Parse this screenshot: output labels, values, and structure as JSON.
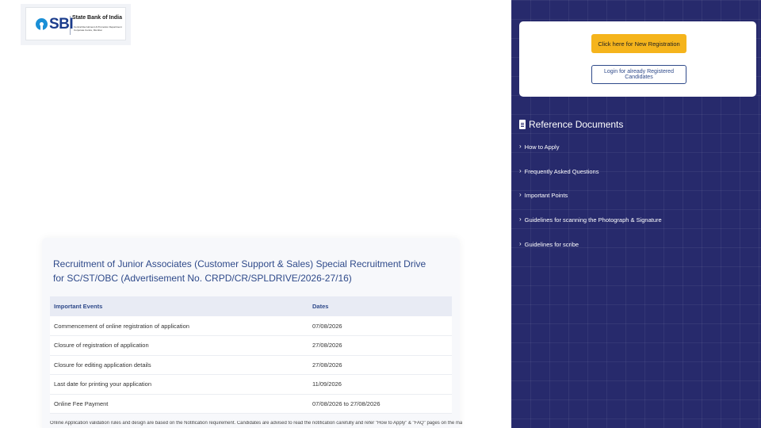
{
  "logo": {
    "brand_text": "SBI",
    "bank_name": "State Bank of India",
    "department_line1": "Central Recruitment & Promotion Department",
    "department_line2": "Corporate Centre, Mumbai"
  },
  "notice": {
    "title": "Recruitment of Junior Associates (Customer Support & Sales) Special Recruitment Drive for SC/ST/OBC (Advertisement No. CRPD/CR/SPLDRIVE/2026-27/16)",
    "table": {
      "headers": [
        "Important Events",
        "Dates"
      ],
      "rows": [
        [
          "Commencement of online registration of application",
          "07/08/2026"
        ],
        [
          "Closure of registration of application",
          "27/08/2026"
        ],
        [
          "Closure for editing application details",
          "27/08/2026"
        ],
        [
          "Last date for printing your application",
          "11/09/2026"
        ],
        [
          "Online Fee Payment",
          "07/08/2026 to 27/08/2026"
        ]
      ]
    },
    "footnote": "Online Application validation rules and design are based on the Notification requirement. Candidates are advised to read the notification carefully and refer \"How to Apply\" & \"FAQ\" pages on the main page. Application submitted through"
  },
  "sidebar": {
    "new_registration_label": "Click here for New Registration",
    "login_label": "Login for already Registered Candidates",
    "reference_heading": "Reference Documents",
    "reference_icon": "document-icon",
    "items": [
      "How to Apply",
      "Frequently Asked Questions",
      "Important Points",
      "Guidelines for scanning the Photograph & Signature",
      "Guidelines for scribe"
    ]
  },
  "colors": {
    "sidebar_bg": "#272a6c",
    "primary_button": "#f5b41c",
    "title_blue": "#2f4a8a"
  }
}
